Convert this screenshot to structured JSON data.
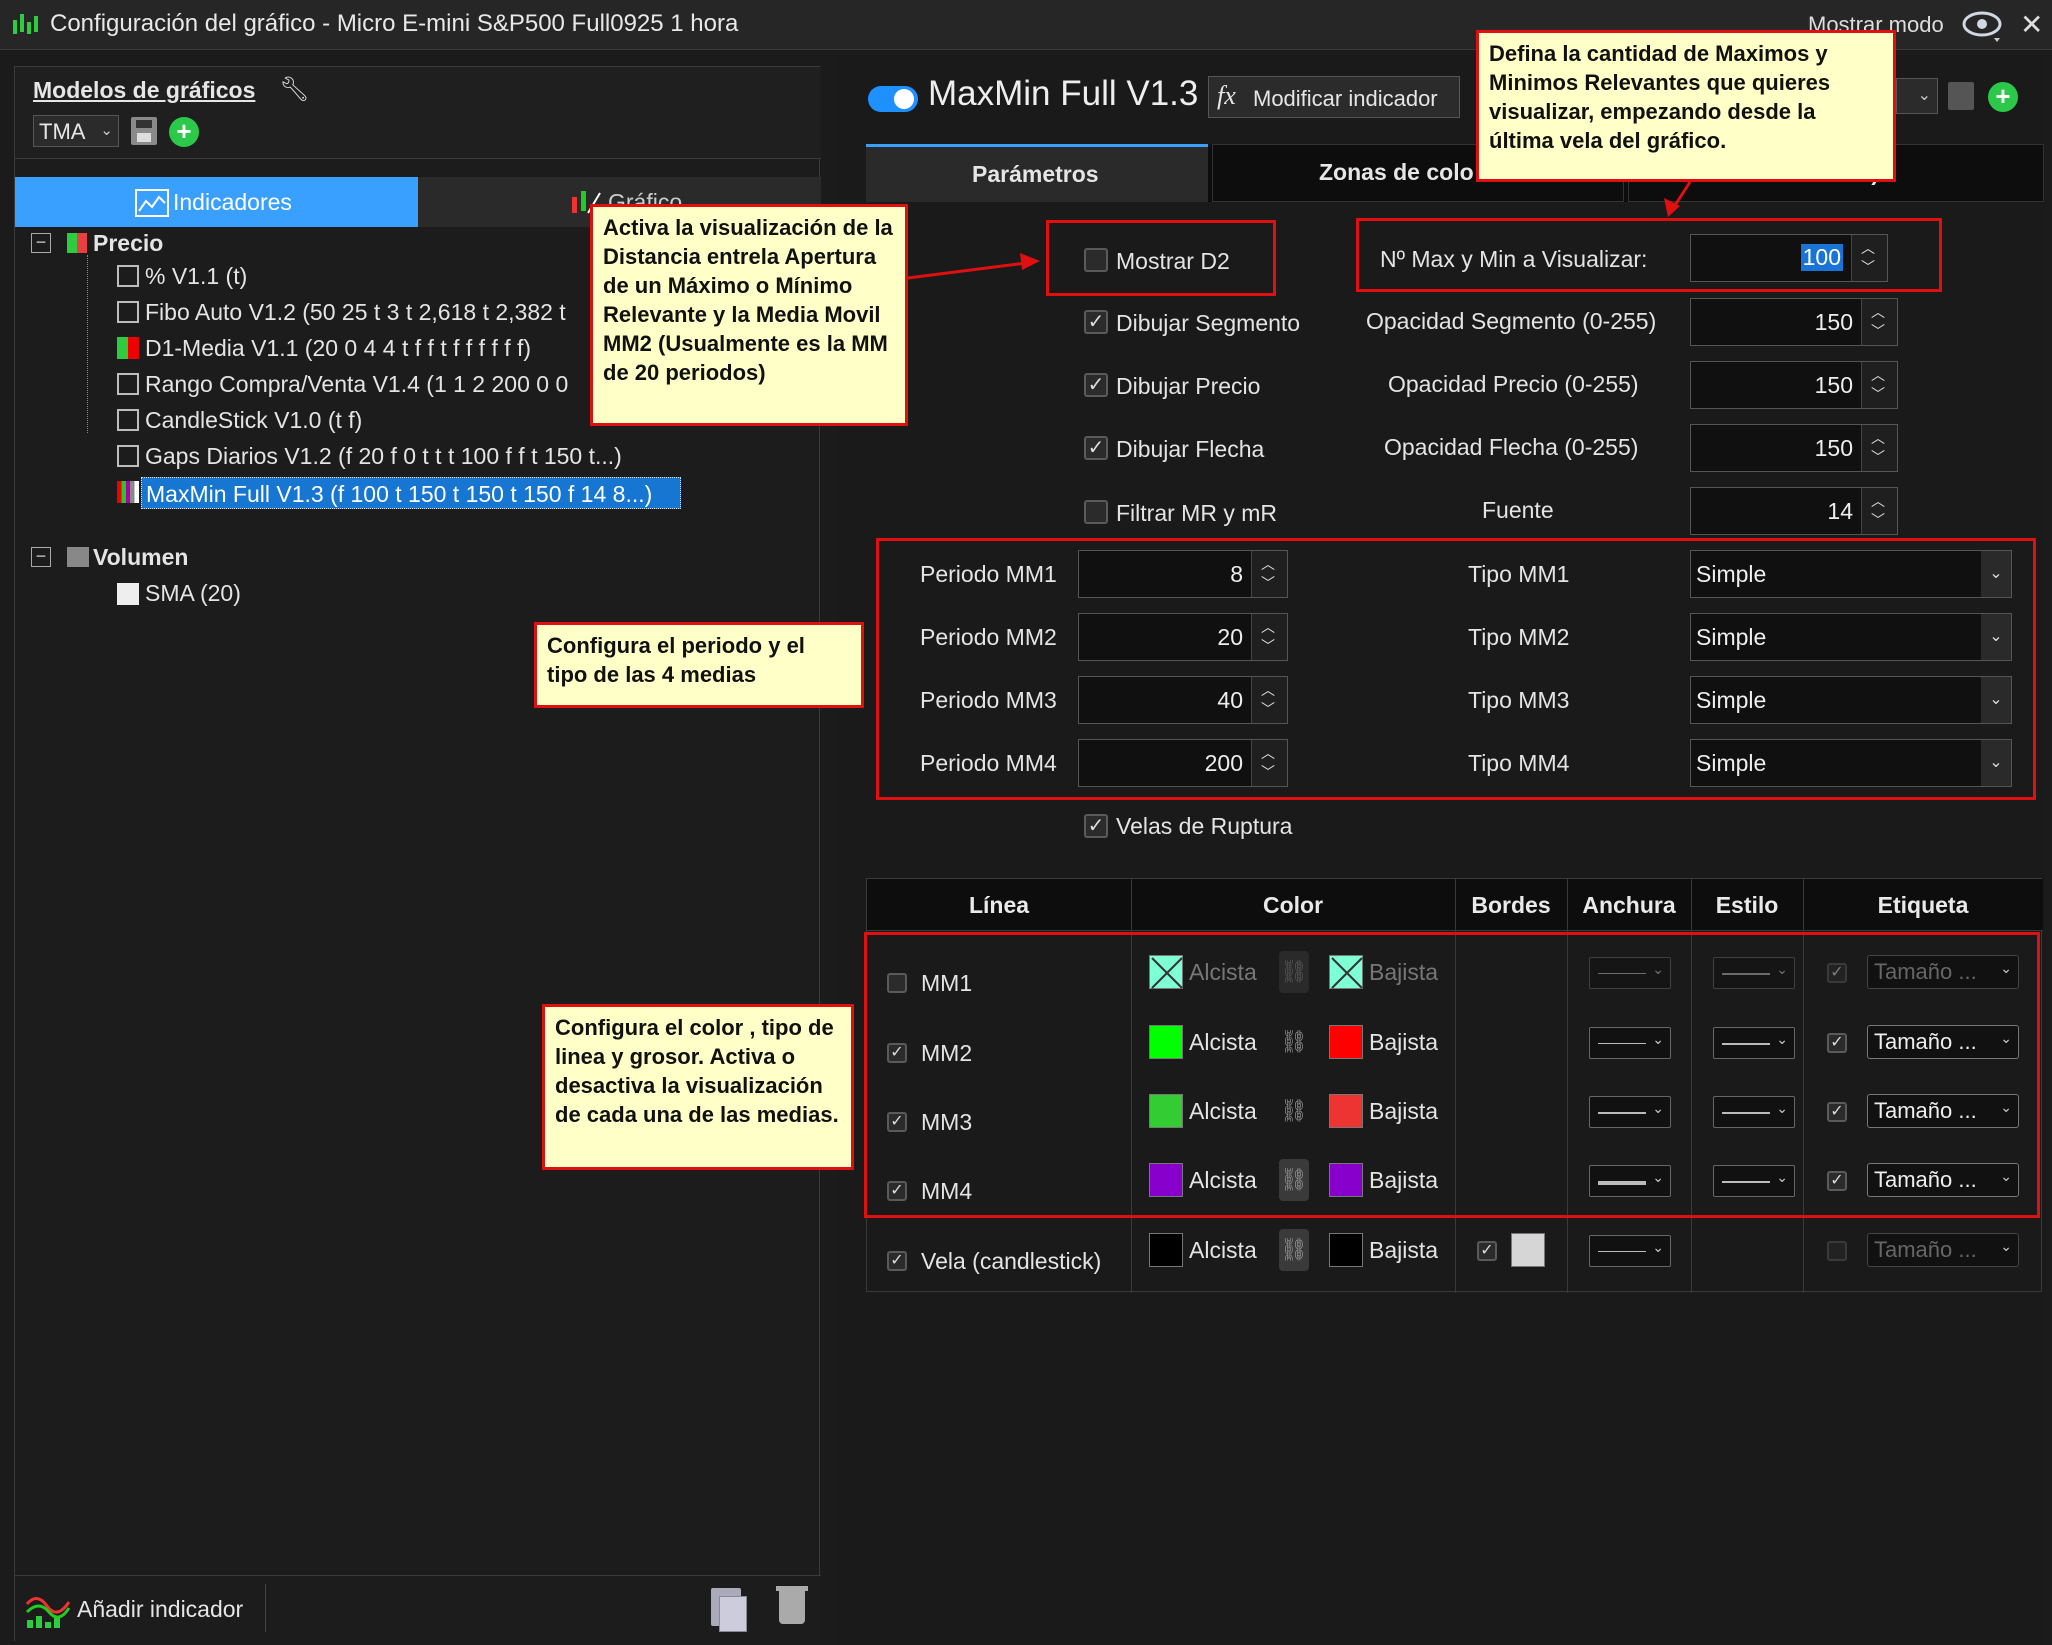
{
  "window": {
    "title": "Configuración del gráfico - Micro E-mini S&P500 Full0925 1 hora",
    "mostrar_modo": "Mostrar modo"
  },
  "left": {
    "models_title": "Modelos de gráficos",
    "model_value": "TMA",
    "tabs": [
      "Indicadores",
      "Gráfico"
    ],
    "tree": {
      "precio": "Precio",
      "precio_items": [
        "% V1.1 (t)",
        "Fibo Auto V1.2 (50 25 t 3 t 2,618 t 2,382 t",
        "D1-Media V1.1 (20 0 4 4 t f f t f f f f f f)",
        "Rango Compra/Venta V1.4 (1 1 2 200 0 0",
        "CandleStick V1.0 (t f)",
        "Gaps Diarios V1.2 (f 20 f 0 t t t 100 f f t 150 t...)",
        "MaxMin Full V1.3 (f 100 t 150 t 150 t 150 f 14 8...)"
      ],
      "volumen": "Volumen",
      "volumen_items": [
        "SMA (20)"
      ]
    },
    "add_indicator": "Añadir indicador"
  },
  "right": {
    "indicator_name": "MaxMin Full V1.3",
    "modify_label": "Modificar indicador",
    "fx": "fx",
    "tabs": [
      "Parámetros",
      "Zonas de colo",
      "l)"
    ],
    "params": {
      "mostrar_d2": "Mostrar D2",
      "dibujar_segmento": "Dibujar Segmento",
      "dibujar_precio": "Dibujar Precio",
      "dibujar_flecha": "Dibujar Flecha",
      "filtrar": "Filtrar MR y mR",
      "max_min_label": "Nº Max y Min a Visualizar:",
      "max_min_value": "100",
      "op_seg_label": "Opacidad Segmento (0-255)",
      "op_seg_value": "150",
      "op_precio_label": "Opacidad Precio (0-255)",
      "op_precio_value": "150",
      "op_flecha_label": "Opacidad Flecha (0-255)",
      "op_flecha_value": "150",
      "fuente_label": "Fuente",
      "fuente_value": "14",
      "mm": [
        {
          "label": "Periodo MM1",
          "value": "8",
          "tipo_label": "Tipo MM1",
          "tipo": "Simple"
        },
        {
          "label": "Periodo MM2",
          "value": "20",
          "tipo_label": "Tipo MM2",
          "tipo": "Simple"
        },
        {
          "label": "Periodo MM3",
          "value": "40",
          "tipo_label": "Tipo MM3",
          "tipo": "Simple"
        },
        {
          "label": "Periodo MM4",
          "value": "200",
          "tipo_label": "Tipo MM4",
          "tipo": "Simple"
        }
      ],
      "velas": "Velas de Ruptura"
    },
    "table": {
      "headers": [
        "Línea",
        "Color",
        "Bordes",
        "Anchura",
        "Estilo",
        "Etiqueta"
      ],
      "rows": [
        {
          "name": "MM1",
          "alcista": "Alcista",
          "bajista": "Bajista",
          "tam": "Tamaño ..."
        },
        {
          "name": "MM2",
          "alcista": "Alcista",
          "bajista": "Bajista",
          "tam": "Tamaño ..."
        },
        {
          "name": "MM3",
          "alcista": "Alcista",
          "bajista": "Bajista",
          "tam": "Tamaño ..."
        },
        {
          "name": "MM4",
          "alcista": "Alcista",
          "bajista": "Bajista",
          "tam": "Tamaño ..."
        },
        {
          "name": "Vela (candlestick)",
          "alcista": "Alcista",
          "bajista": "Bajista",
          "tam": "Tamaño ..."
        }
      ],
      "colors": {
        "mm1_up": "#7fffd4",
        "mm1_down": "#7fffd4",
        "mm2_up": "#00ff00",
        "mm2_down": "#ff0000",
        "mm3_up": "#33cc33",
        "mm3_down": "#ee3333",
        "mm4_up": "#8800cc",
        "mm4_down": "#8800cc",
        "vela_up": "#000000",
        "vela_down": "#000000"
      }
    }
  },
  "callouts": {
    "maxmin": "Defina la cantidad de Maximos y Minimos Relevantes que quieres visualizar, empezando desde la última vela del gráfico.",
    "d2": "Activa la visualización de la Distancia entrela Apertura de un Máximo o Mínimo Relevante y la Media Movil MM2 (Usualmente es la MM de 20 periodos)",
    "medias": "Configura el periodo y el tipo de las 4 medias",
    "color": "Configura el color , tipo de linea y grosor. Activa o desactiva la visualización de cada una de las medias."
  }
}
